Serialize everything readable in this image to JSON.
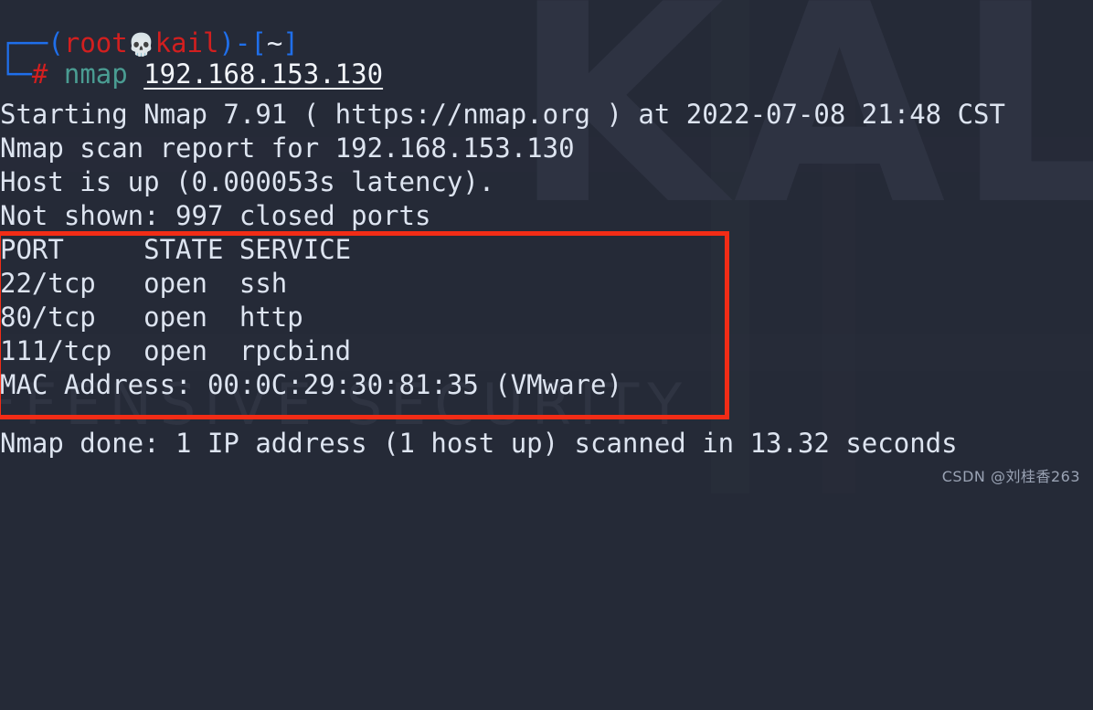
{
  "terminal": {
    "background_color": "#252a37",
    "foreground_color": "#dfe6f2",
    "prompt": {
      "bracket_top": "┌──",
      "bracket_bottom": "└─",
      "paren_open": "(",
      "user": "root",
      "separator_icon": "💀",
      "host": "kail",
      "paren_close": ")",
      "dash": "-",
      "bracket_open": "[",
      "path": "~",
      "bracket_close": "]",
      "sigil": "#",
      "command": "nmap",
      "argument": "192.168.153.130",
      "user_color": "#d21f1f",
      "bracket_color": "#1f6feb",
      "command_color": "#4a9c92",
      "argument_color": "#f2f5fa"
    },
    "output": {
      "line1": "Starting Nmap 7.91 ( https://nmap.org ) at 2022-07-08 21:48 CST",
      "line2": "Nmap scan report for 192.168.153.130",
      "line3": "Host is up (0.000053s latency).",
      "line4": "Not shown: 997 closed ports",
      "table_header": "PORT     STATE SERVICE",
      "row1": "22/tcp   open  ssh",
      "row2": "80/tcp   open  http",
      "row3": "111/tcp  open  rpcbind",
      "mac_line": "MAC Address: 00:0C:29:30:81:35 (VMware)",
      "done_line": "Nmap done: 1 IP address (1 host up) scanned in 13.32 seconds"
    },
    "scan_results": {
      "target": "192.168.153.130",
      "nmap_version": "7.91",
      "scan_timestamp": "2022-07-08 21:48 CST",
      "host_status": "up",
      "latency": "0.000053s",
      "closed_ports_not_shown": "997",
      "mac_address": "00:0C:29:30:81:35",
      "mac_vendor": "VMware",
      "duration": "13.32 seconds",
      "hosts_scanned": "1",
      "columns": [
        "PORT",
        "STATE",
        "SERVICE"
      ],
      "ports": [
        {
          "port": "22/tcp",
          "state": "open",
          "service": "ssh"
        },
        {
          "port": "80/tcp",
          "state": "open",
          "service": "http"
        },
        {
          "port": "111/tcp",
          "state": "open",
          "service": "rpcbind"
        }
      ]
    }
  },
  "annotation": {
    "highlight_box_color": "#f22c16",
    "highlight_label": "port-table-highlight"
  },
  "watermarks": {
    "kali": "KALI",
    "offensive_security": "FFENSIVE SECURITY",
    "csdn": "CSDN @刘桂香263"
  }
}
